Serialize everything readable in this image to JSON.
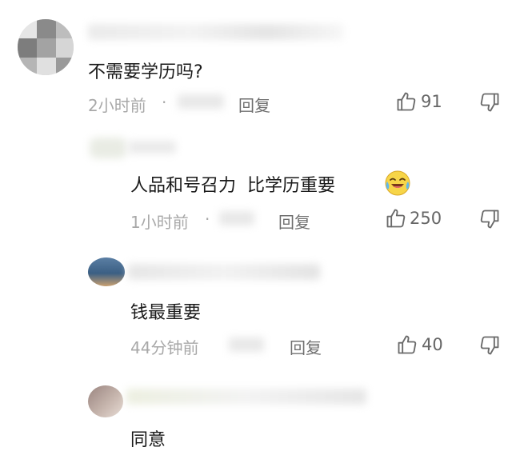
{
  "comments": [
    {
      "text": "不需要学历吗?",
      "time": "2小时前",
      "separator": "·",
      "reply_label": "回复",
      "likes": "91"
    },
    {
      "text": "人品和号召力  比学历重要",
      "time": "1小时前",
      "separator": "·",
      "reply_label": "回复",
      "likes": "250"
    },
    {
      "text": "钱最重要",
      "time": "44分钟前",
      "reply_label": "回复",
      "likes": "40"
    },
    {
      "text": "同意"
    }
  ],
  "icons": {
    "like": "thumbs-up-icon",
    "dislike": "thumbs-down-icon",
    "emoji": "laughing-crying-emoji-icon"
  },
  "colors": {
    "meta_text": "#a8a8a8",
    "reply_text": "#6f6f6f",
    "icon_stroke": "#6a6a6a"
  }
}
